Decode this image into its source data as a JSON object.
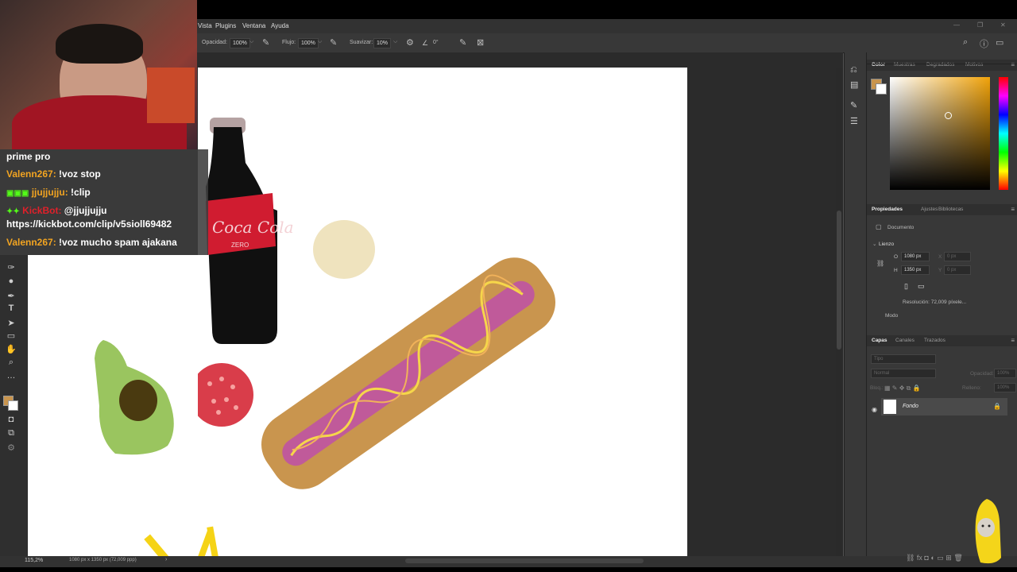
{
  "menu": [
    "Vista",
    "Plugins",
    "Ventana",
    "Ayuda"
  ],
  "options": {
    "opacity_label": "Opacidad:",
    "opacity_value": "100%",
    "flow_label": "Flujo:",
    "flow_value": "100%",
    "smooth_label": "Suavizar:",
    "smooth_value": "10%",
    "angle_value": "0°"
  },
  "color_panel": {
    "tabs": [
      "Color",
      "Muestras",
      "Degradados",
      "Motivos"
    ],
    "foreground_color": "#c9954e",
    "accent": "#f1a30a"
  },
  "properties_panel": {
    "tabs": [
      "Propiedades",
      "Ajustes",
      "Bibliotecas"
    ],
    "document_label": "Documento",
    "section_label": "Lienzo",
    "width_label": "O",
    "width_value": "1080 px",
    "height_label": "H",
    "height_value": "1350 px",
    "x_label": "X",
    "x_value": "0 px",
    "y_label": "Y",
    "y_value": "0 px",
    "resolution": "Resolución: 72,009 píxele...",
    "mode_label": "Modo"
  },
  "layers_panel": {
    "tabs": [
      "Capas",
      "Canales",
      "Trazados"
    ],
    "search_placeholder": "Tipo",
    "blend_mode": "Normal",
    "opacity_label": "Opacidad:",
    "opacity_value": "100%",
    "lock_label": "Bloq.:",
    "fill_label": "Relleno:",
    "fill_value": "100%",
    "layers": [
      {
        "name": "Fondo",
        "visible": true,
        "locked": true
      }
    ]
  },
  "status": {
    "zoom": "115,2%",
    "doc_info": "1080 px x 1350 px (72,009 ppp)"
  },
  "chat": {
    "lines": [
      {
        "user": "",
        "text": "prime pro"
      },
      {
        "user": "Valenn267:",
        "text": " !voz stop"
      },
      {
        "user": "jjujjujju:",
        "text": " !clip"
      },
      {
        "user": "KickBot:",
        "text": " @jjujjujju"
      },
      {
        "user": "",
        "text": "https://kickbot.com/clip/v5sioll69482"
      },
      {
        "user": "Valenn267:",
        "text": " !voz mucho spam ajakana"
      }
    ]
  },
  "canvas_art": {
    "bottle_label": "Coca Cola",
    "bottle_sublabel": "ZERO"
  }
}
